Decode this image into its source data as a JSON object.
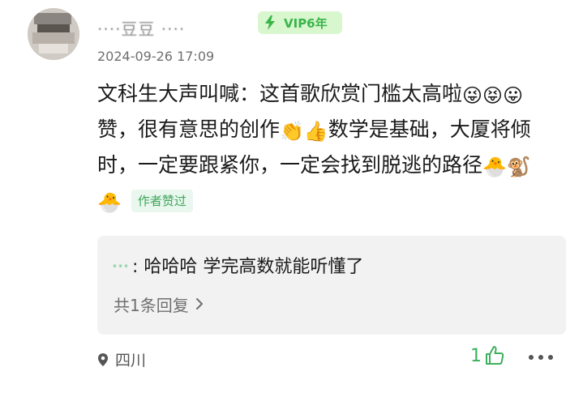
{
  "comment": {
    "username": "····豆豆 ····",
    "vip_badge": "VIP6年",
    "timestamp": "2024-09-26 17:09",
    "text_part1": "文科生大声叫喊：这首歌欣赏门槛太高啦",
    "text_part2": "赞，很有意思的创作",
    "text_part3": "数学是基础，大厦将倾时，一定要跟紧你，一定会找到脱逃的路径",
    "emoji_1": "😜",
    "emoji_2": "😝",
    "emoji_3": "😛",
    "emoji_4": "👏",
    "emoji_5": "👍",
    "emoji_6": "🐣",
    "emoji_7": "🐒",
    "emoji_8": "🐣",
    "author_liked_tag": "作者赞过",
    "location": "四川",
    "like_count": "1"
  },
  "reply": {
    "username": "···",
    "text": "哈哈哈 学完高数就能听懂了",
    "count_label": "共1条回复"
  },
  "colors": {
    "accent_green": "#3eaf5c",
    "vip_bg": "#d9f7cf",
    "reply_bg": "#f2f2f2"
  },
  "icons": {
    "location": "location-pin-icon",
    "like": "thumbs-up-icon",
    "more": "more-dots-icon",
    "chevron": "chevron-right-icon",
    "vip": "lightning-icon"
  }
}
